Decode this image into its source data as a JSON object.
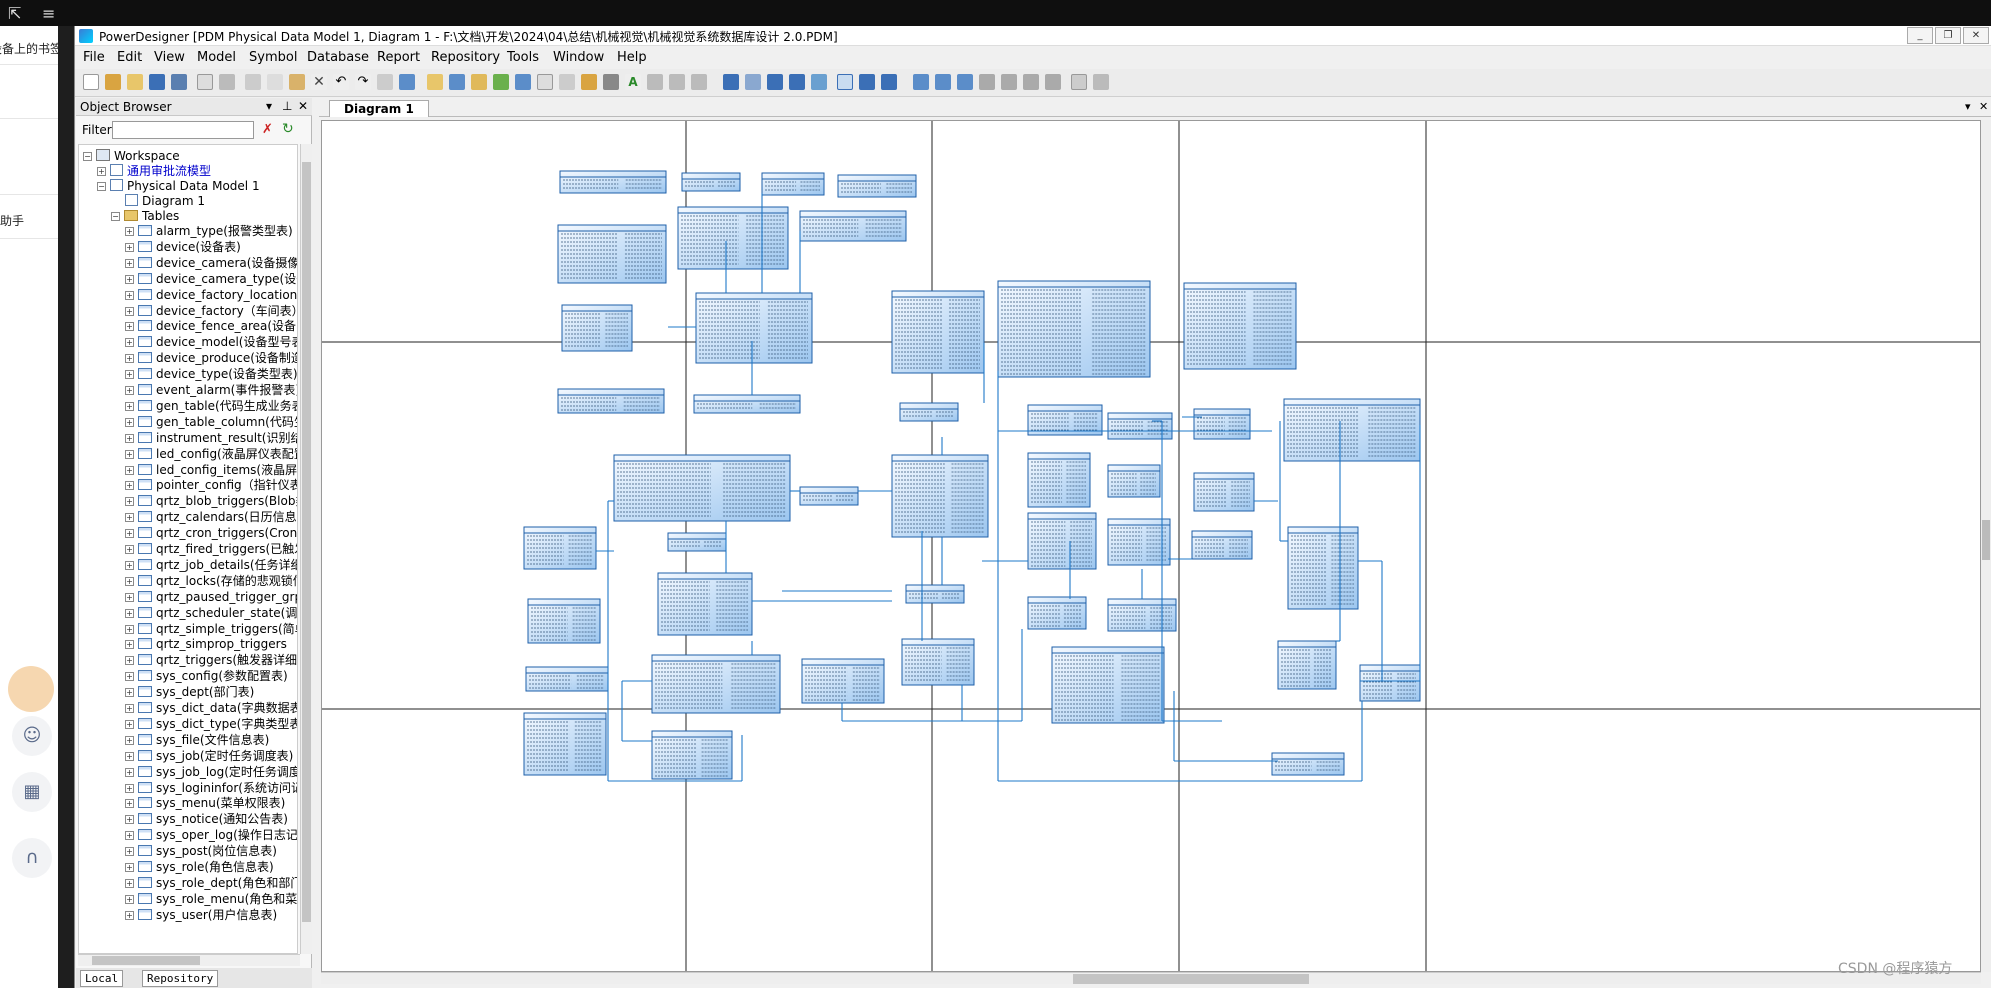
{
  "browser_strip": {
    "bookmarks_text": "设备上的书签",
    "assistant_text": "助手"
  },
  "window": {
    "title": "PowerDesigner [PDM Physical Data Model 1, Diagram 1 - F:\\文档\\开发\\2024\\04\\总结\\机械视觉\\机械视觉系统数据库设计 2.0.PDM]"
  },
  "menu": [
    "File",
    "Edit",
    "View",
    "Model",
    "Symbol",
    "Database",
    "Report",
    "Repository",
    "Tools",
    "Window",
    "Help"
  ],
  "object_browser": {
    "title": "Object Browser",
    "filter_label": "Filter:",
    "tree": {
      "workspace": "Workspace",
      "model_1": "通用审批流模型",
      "model_2": "Physical Data Model 1",
      "diagram": "Diagram 1",
      "tables_folder": "Tables",
      "tables": [
        "alarm_type(报警类型表)",
        "device(设备表)",
        "device_camera(设备摄像头",
        "device_camera_type(设备摄",
        "device_factory_location(车",
        "device_factory（车间表）",
        "device_fence_area(设备电",
        "device_model(设备型号表",
        "device_produce(设备制造",
        "device_type(设备类型表)",
        "event_alarm(事件报警表)",
        "gen_table(代码生成业务表",
        "gen_table_column(代码生",
        "instrument_result(识别结果",
        "led_config(液晶屏仪表配置",
        "led_config_items(液晶屏仪",
        "pointer_config（指针仪表",
        "qrtz_blob_triggers(Blob类型",
        "qrtz_calendars(日历信息表",
        "qrtz_cron_triggers(Cron类型",
        "qrtz_fired_triggers(已触发的",
        "qrtz_job_details(任务详细信",
        "qrtz_locks(存储的悲观锁信",
        "qrtz_paused_trigger_grps(暂",
        "qrtz_scheduler_state(调度器",
        "qrtz_simple_triggers(简单触",
        "qrtz_simprop_triggers",
        "qrtz_triggers(触发器详细信",
        "sys_config(参数配置表)",
        "sys_dept(部门表)",
        "sys_dict_data(字典数据表",
        "sys_dict_type(字典类型表",
        "sys_file(文件信息表)",
        "sys_job(定时任务调度表)",
        "sys_job_log(定时任务调度",
        "sys_logininfor(系统访问记",
        "sys_menu(菜单权限表)",
        "sys_notice(通知公告表)",
        "sys_oper_log(操作日志记",
        "sys_post(岗位信息表)",
        "sys_role(角色信息表)",
        "sys_role_dept(角色和部门",
        "sys_role_menu(角色和菜单",
        "sys_user(用户信息表)"
      ]
    },
    "bottom_tabs": [
      "Local",
      "Repository"
    ]
  },
  "diagram_tab": "Diagram 1",
  "watermark": "CSDN @程序猿方"
}
